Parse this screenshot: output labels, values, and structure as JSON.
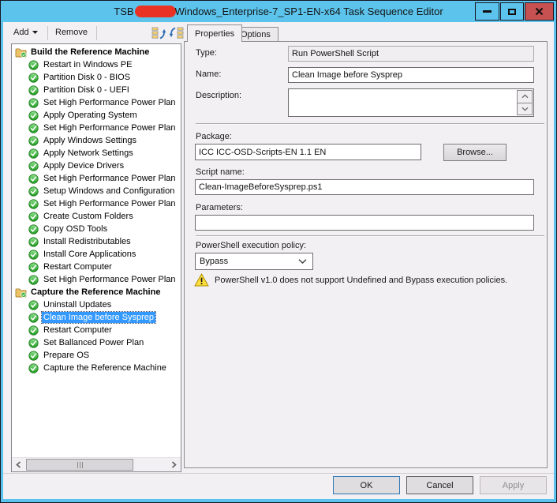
{
  "window": {
    "title_prefix": "TSB",
    "title_suffix": "Windows_Enterprise-7_SP1-EN-x64 Task Sequence Editor"
  },
  "toolbar": {
    "add": "Add",
    "remove": "Remove"
  },
  "tabs": {
    "properties": "Properties",
    "options": "Options"
  },
  "tree": {
    "groups": [
      {
        "label": "Build the Reference Machine",
        "items": [
          "Restart in Windows PE",
          "Partition Disk 0 - BIOS",
          "Partition Disk 0 - UEFI",
          "Set High Performance Power Plan",
          "Apply Operating System",
          "Set High Performance Power Plan",
          "Apply Windows Settings",
          "Apply Network Settings",
          "Apply Device Drivers",
          "Set High Performance Power Plan",
          "Setup Windows and Configuration",
          "Set High Performance Power Plan",
          "Create Custom Folders",
          "Copy OSD Tools",
          "Install Redistributables",
          "Install Core Applications",
          "Restart Computer",
          "Set High Performance Power Plan"
        ]
      },
      {
        "label": "Capture the Reference Machine",
        "selected_index": 1,
        "items": [
          "Uninstall Updates",
          "Clean Image before Sysprep",
          "Restart Computer",
          "Set Ballanced Power Plan",
          "Prepare OS",
          "Capture the Reference Machine"
        ]
      }
    ]
  },
  "properties": {
    "type_label": "Type:",
    "type_value": "Run PowerShell Script",
    "name_label": "Name:",
    "name_value": "Clean Image before Sysprep",
    "description_label": "Description:",
    "description_value": "",
    "package_label": "Package:",
    "package_value": "ICC ICC-OSD-Scripts-EN 1.1 EN",
    "browse_label": "Browse...",
    "script_label": "Script name:",
    "script_value": "Clean-ImageBeforeSysprep.ps1",
    "parameters_label": "Parameters:",
    "parameters_value": "",
    "policy_label": "PowerShell execution policy:",
    "policy_value": "Bypass",
    "warning_text": "PowerShell v1.0 does not support Undefined and Bypass execution policies."
  },
  "buttons": {
    "ok": "OK",
    "cancel": "Cancel",
    "apply": "Apply"
  },
  "colors": {
    "titlebar_blue": "#5CC4EC",
    "close_button_red": "#C75050",
    "selection_blue": "#3399FF",
    "redaction_red": "#E93223",
    "warning_yellow": "#FFDE3C",
    "status_green": "#2FAE2F"
  }
}
